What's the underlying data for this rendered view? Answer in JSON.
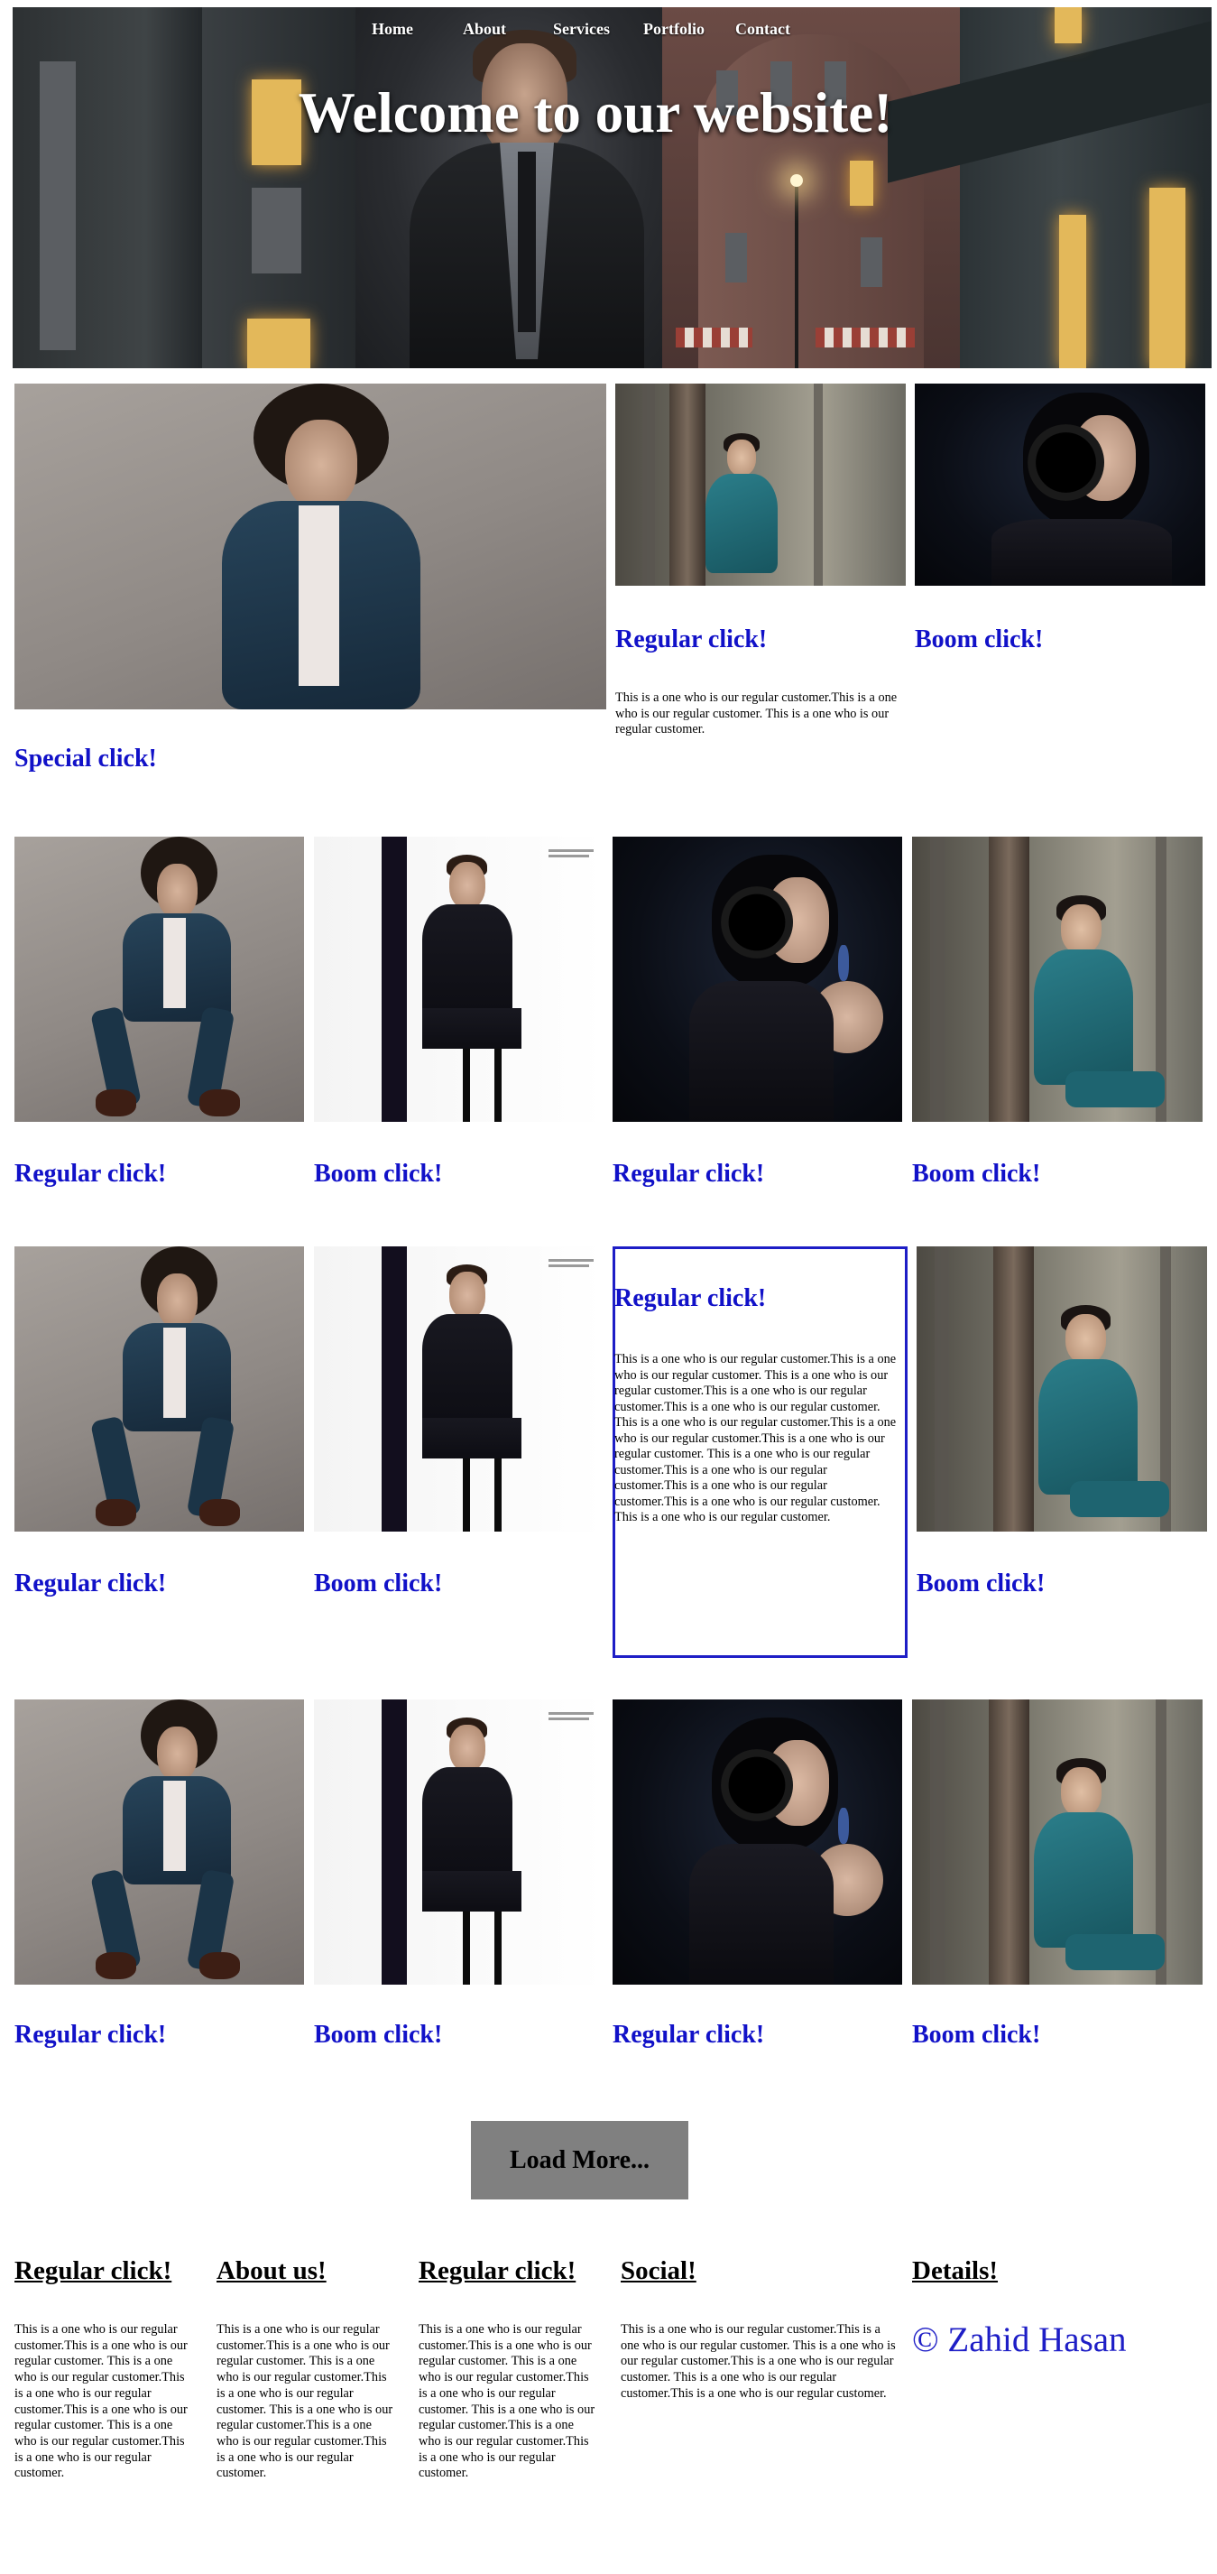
{
  "nav": {
    "items": [
      "Home",
      "About",
      "Services",
      "Portfolio",
      "Contact"
    ]
  },
  "hero": {
    "title": "Welcome to our website!"
  },
  "featured": {
    "main_title": "Special click!",
    "card1_title": "Regular click!",
    "card1_text": "This is a one who is our regular customer.This is a one who is our regular customer. This is a one who is our regular customer.",
    "card2_title": "Boom click!"
  },
  "gallery": {
    "row1": [
      "Regular click!",
      "Boom click!",
      "Regular click!",
      "Boom click!"
    ],
    "row2": [
      "Regular click!",
      "Boom click!",
      "Regular click!",
      "Boom click!"
    ],
    "row2_box_text": "This is a one who is our regular customer.This is a one who is our regular customer. This is a one who is our regular customer.This is a one who is our regular customer.This is a one who is our regular customer. This is a one who is our regular customer.This is a one who is our regular customer.This is a one who is our regular customer. This is a one who is our regular customer.This is a one who is our regular customer.This is a one who is our regular customer.This is a one who is our regular customer. This is a one who is our regular customer.",
    "row3": [
      "Regular click!",
      "Boom click!",
      "Regular click!",
      "Boom click!"
    ]
  },
  "load_more": "Load More...",
  "footer": {
    "col1_title": "Regular click!",
    "col1_text": "This is a one who is our regular customer.This is a one who is our regular customer. This is a one who is our regular customer.This is a one who is our regular customer.This is a one who is our regular customer. This is a one who is our regular customer.This is a one who is our regular customer.",
    "col2_title": "About us!",
    "col2_text": "This is a one who is our regular customer.This is a one who is our regular customer. This is a one who is our regular customer.This is a one who is our regular customer. This is a one who is our regular customer.This is a one who is our regular customer.This is a one who is our regular customer.",
    "col3_title": "Regular click!",
    "col3_text": "This is a one who is our regular customer.This is a one who is our regular customer. This is a one who is our regular customer.This is a one who is our regular customer. This is a one who is our regular customer.This is a one who is our regular customer.This is a one who is our regular customer.",
    "col4_title": "Social!",
    "col4_text": "This is a one who is our regular customer.This is a one who is our regular customer. This is a one who is our regular customer.This is a one who is our regular customer. This is a one who is our regular customer.This is a one who is our regular customer.",
    "col5_title": "Details!",
    "copyright": "© Zahid Hasan"
  },
  "colors": {
    "link_blue": "#1111c8",
    "button_gray": "#808080",
    "box_border": "#1e1ec6"
  }
}
